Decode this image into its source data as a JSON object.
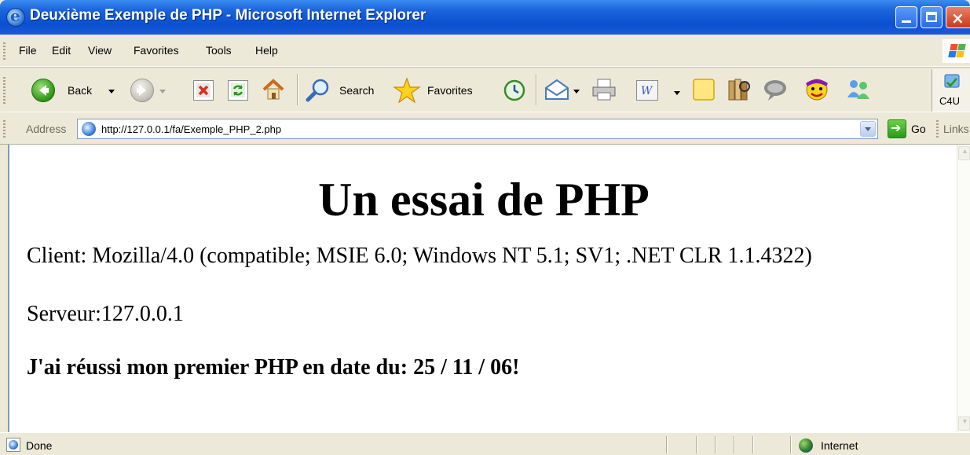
{
  "window": {
    "title": "Deuxième Exemple de PHP - Microsoft Internet Explorer",
    "buttons": {
      "minimize": "",
      "maximize": "",
      "close": "×"
    }
  },
  "menubar": {
    "items": [
      {
        "label": "File"
      },
      {
        "label": "Edit"
      },
      {
        "label": "View"
      },
      {
        "label": "Favorites"
      },
      {
        "label": "Tools"
      },
      {
        "label": "Help"
      }
    ]
  },
  "toolbar": {
    "back_label": "Back",
    "search_label": "Search",
    "favorites_label": "Favorites",
    "c4u_label": "C4U",
    "icons": [
      "back-icon",
      "forward-icon",
      "stop-icon",
      "refresh-icon",
      "home-icon",
      "search-icon",
      "favorites-icon",
      "history-icon",
      "mail-icon",
      "print-icon",
      "edit-icon",
      "discuss-icon",
      "research-icon",
      "messenger-icon",
      "yahoo-messenger-icon",
      "msn-buddies-icon",
      "c4u-icon"
    ]
  },
  "addressbar": {
    "label": "Address",
    "url": "http://127.0.0.1/fa/Exemple_PHP_2.php",
    "go_label": "Go",
    "links_label": "Links"
  },
  "page": {
    "heading": "Un essai de PHP",
    "client": "Client: Mozilla/4.0 (compatible; MSIE 6.0; Windows NT 5.1; SV1; .NET CLR 1.1.4322)",
    "server": "Serveur:127.0.0.1",
    "message": "J'ai réussi mon premier PHP en date du: 25 / 11 / 06!"
  },
  "statusbar": {
    "status": "Done",
    "zone": "Internet"
  },
  "colors": {
    "titlebar": "#0a50d0",
    "chrome": "#ece9d8",
    "content_bg": "#ffffff"
  }
}
